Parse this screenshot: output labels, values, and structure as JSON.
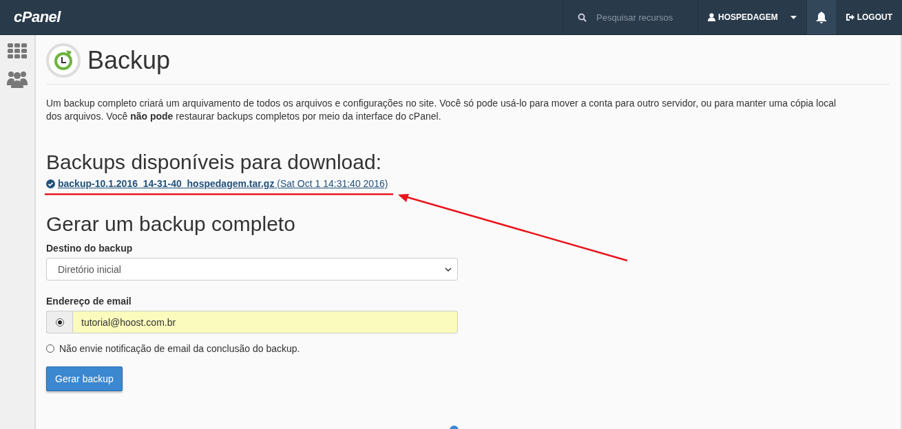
{
  "topbar": {
    "logo": "cPanel",
    "search": {
      "placeholder": "Pesquisar recursos"
    },
    "user": "HOSPEDAGEM",
    "logout": "LOGOUT"
  },
  "page": {
    "title": "Backup",
    "description": "Um backup completo criará um arquivamento de todos os arquivos e configurações no site. Você só pode usá-lo para mover a conta para outro servidor, ou para manter uma cópia local dos arquivos. Você **não pode** restaurar backups completos por meio da interface do cPanel."
  },
  "available": {
    "heading": "Backups disponíveis para download:",
    "files": [
      {
        "name": "backup-10.1.2016_14-31-40_hospedagem.tar.gz",
        "date": "(Sat Oct 1 14:31:40 2016)"
      }
    ]
  },
  "generate": {
    "heading": "Gerar um backup completo",
    "destination": {
      "label": "Destino do backup",
      "value": "Diretório inicial"
    },
    "email": {
      "label": "Endereço de email",
      "value": "tutorial@hoost.com.br",
      "selected": true
    },
    "no_notify": {
      "label": "Não envie notificação de email da conclusão do backup.",
      "selected": false
    },
    "button": "Gerar backup"
  }
}
